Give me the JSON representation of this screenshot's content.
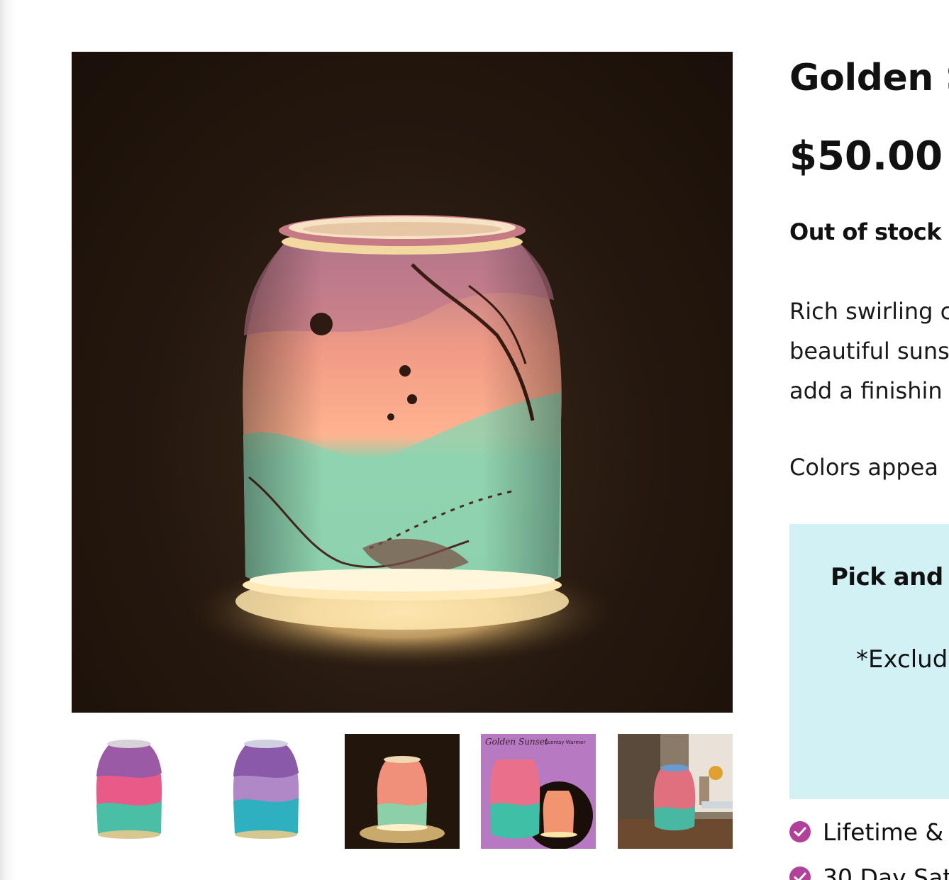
{
  "product": {
    "title": "Golden S",
    "price": "$50.00",
    "stock_status": "Out of stock",
    "description_lines": [
      "Rich swirling c",
      "beautiful suns",
      "add a finishin"
    ],
    "colors_note": "Colors  appea"
  },
  "promo": {
    "title": "Pick and c",
    "note": "*Exclud"
  },
  "features": [
    "Lifetime & I",
    "30 Day Sat"
  ],
  "thumbnails": [
    {
      "name": "thumb-sunset-lit-pink"
    },
    {
      "name": "thumb-sunset-blue"
    },
    {
      "name": "thumb-sunset-dark"
    },
    {
      "name": "thumb-golden-sunset-promo",
      "script_text": "Golden Sunset",
      "caption": "Scentsy Warmer"
    },
    {
      "name": "thumb-sunset-shelf"
    }
  ],
  "colors": {
    "accent": "#b2419a",
    "promo_bg": "#d2f1f5"
  }
}
